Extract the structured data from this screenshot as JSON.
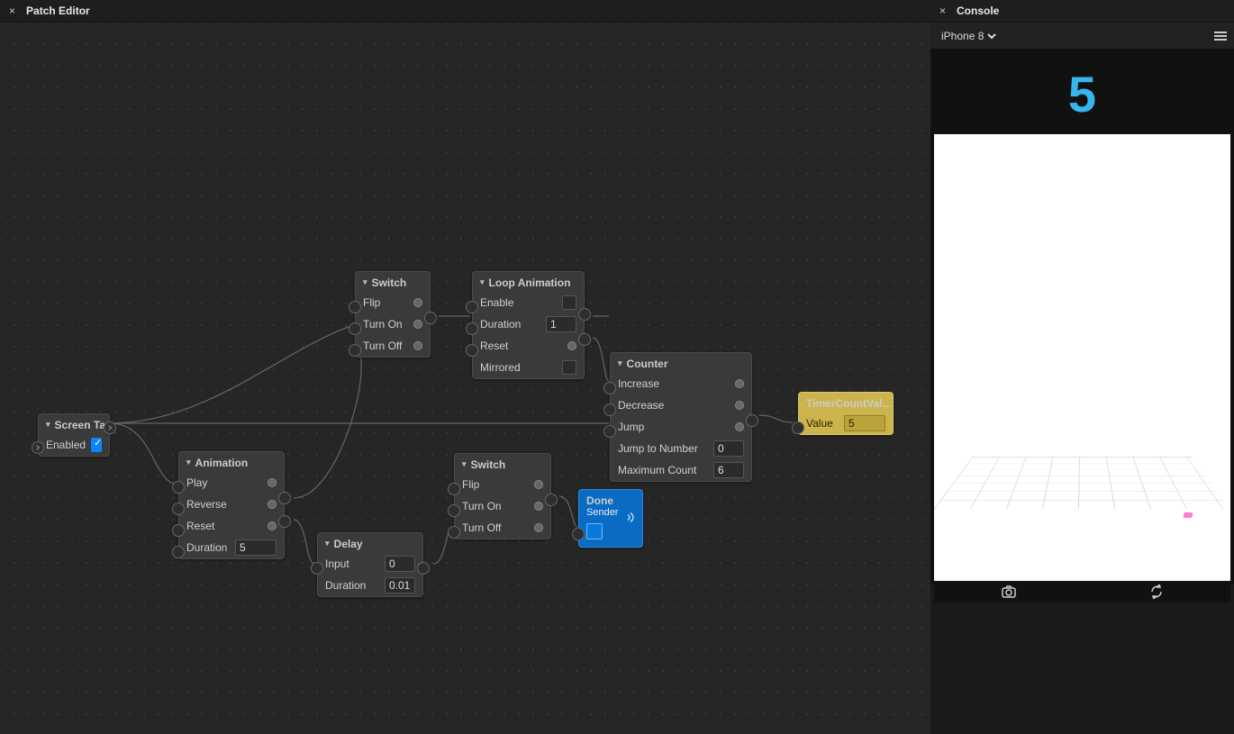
{
  "left_panel": {
    "title": "Patch Editor"
  },
  "right_panel": {
    "title": "Console",
    "device": "iPhone 8"
  },
  "nodes": {
    "screen_tap": {
      "title": "Screen Tap",
      "enabled": true
    },
    "animation": {
      "title": "Animation",
      "play": "Play",
      "reverse": "Reverse",
      "reset": "Reset",
      "duration_label": "Duration",
      "duration": "5"
    },
    "switch1": {
      "title": "Switch",
      "flip": "Flip",
      "turn_on": "Turn On",
      "turn_off": "Turn Off"
    },
    "switch2": {
      "title": "Switch",
      "flip": "Flip",
      "turn_on": "Turn On",
      "turn_off": "Turn Off"
    },
    "delay": {
      "title": "Delay",
      "input": "Input",
      "input_val": "0",
      "duration_label": "Duration",
      "duration": "0.01"
    },
    "loop": {
      "title": "Loop Animation",
      "enable": "Enable",
      "duration_label": "Duration",
      "duration": "1",
      "reset": "Reset",
      "mirrored": "Mirrored"
    },
    "counter": {
      "title": "Counter",
      "increase": "Increase",
      "decrease": "Decrease",
      "jump": "Jump",
      "jtn": "Jump to Number",
      "jtn_val": "0",
      "max": "Maximum Count",
      "max_val": "6"
    },
    "done": {
      "title": "Done",
      "sub": "Sender"
    },
    "timer": {
      "title": "TimerCountVal…",
      "value_label": "Value",
      "value": "5"
    }
  },
  "preview": {
    "big_number": "5"
  }
}
